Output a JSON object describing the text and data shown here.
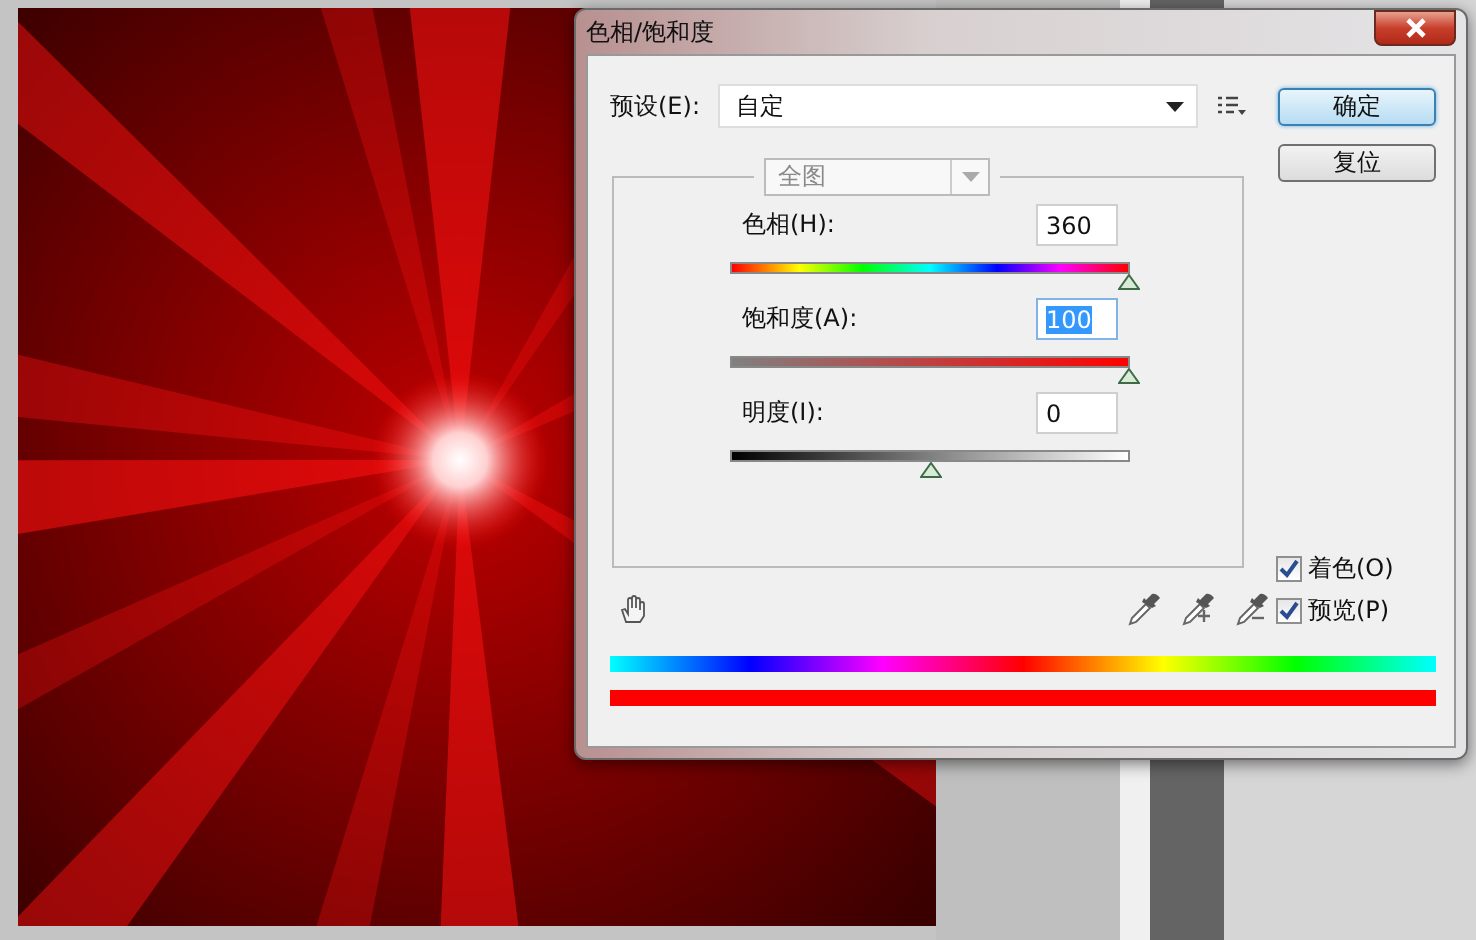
{
  "window": {
    "title": "色相/饱和度"
  },
  "preset": {
    "label": "预设(E):",
    "value": "自定"
  },
  "buttons": [
    {
      "label": "确定",
      "default": true
    },
    {
      "label": "复位",
      "default": false
    }
  ],
  "edit_range": {
    "value": "全图",
    "disabled": true
  },
  "sliders": [
    {
      "kind": "hue",
      "label": "色相(H):",
      "value": "360",
      "level": 1,
      "focused": false
    },
    {
      "kind": "saturation",
      "label": "饱和度(A):",
      "value": "100",
      "level": 1,
      "focused": true
    },
    {
      "kind": "lightness",
      "label": "明度(I):",
      "value": "0",
      "level": 0.5,
      "focused": false
    }
  ],
  "checkboxes": [
    {
      "label": "着色(O)",
      "checked": true
    },
    {
      "label": "预览(P)",
      "checked": true
    }
  ]
}
